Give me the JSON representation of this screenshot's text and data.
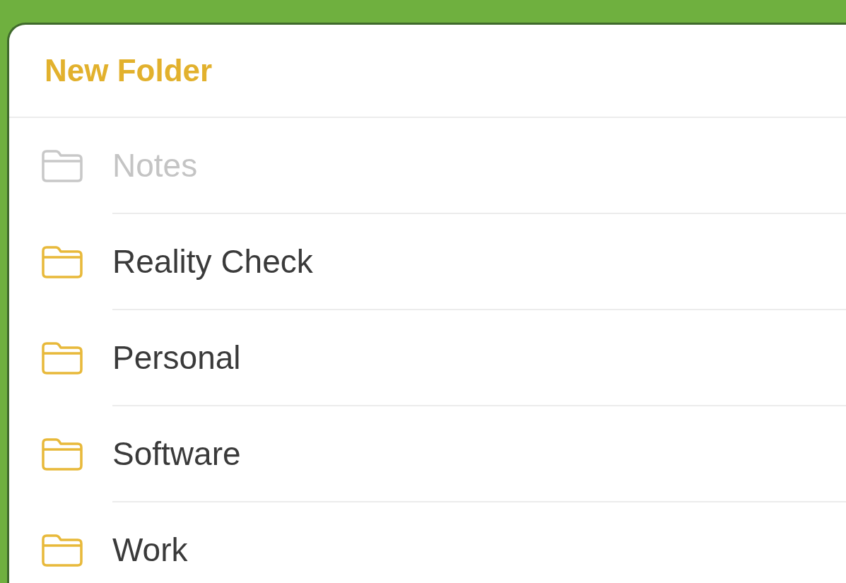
{
  "header": {
    "title": "New Folder"
  },
  "folders": [
    {
      "label": "Notes",
      "disabled": true
    },
    {
      "label": "Reality Check",
      "disabled": false
    },
    {
      "label": "Personal",
      "disabled": false
    },
    {
      "label": "Software",
      "disabled": false
    },
    {
      "label": "Work",
      "disabled": false
    }
  ]
}
